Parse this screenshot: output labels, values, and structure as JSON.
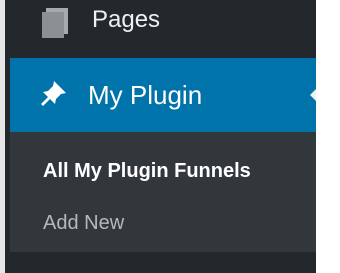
{
  "menu": {
    "pages_label": "Pages",
    "current_label": "My Plugin",
    "pages_icon": "pages-icon",
    "current_icon": "pushpin-icon",
    "submenu": {
      "all_label": "All My Plugin Funnels",
      "add_label": "Add New"
    }
  },
  "colors": {
    "menu_bg": "#23282d",
    "active_bg": "#0073aa",
    "submenu_bg": "#32373c",
    "text": "#ffffff",
    "muted_text": "#b4b9be"
  }
}
